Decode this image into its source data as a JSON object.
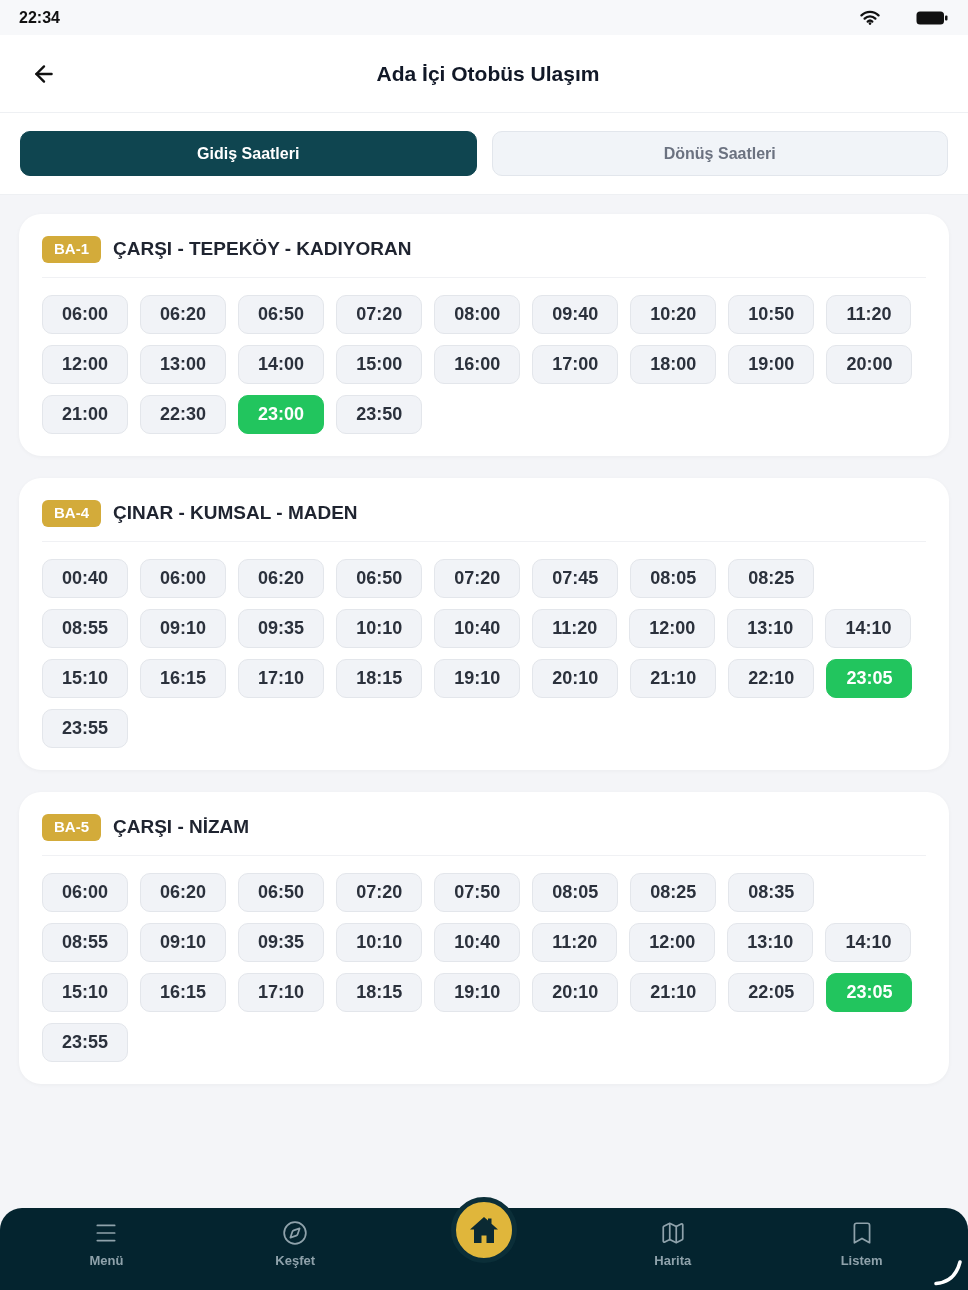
{
  "status_bar": {
    "time": "22:34"
  },
  "header": {
    "title": "Ada İçi Otobüs Ulaşım"
  },
  "tabs": [
    {
      "label": "Gidiş Saatleri",
      "selected": true
    },
    {
      "label": "Dönüş Saatleri",
      "selected": false
    }
  ],
  "routes": [
    {
      "code": "BA-1",
      "name": "ÇARŞI - TEPEKÖY - KADIYORAN",
      "rows": [
        [
          {
            "time": "06:00",
            "highlighted": false
          },
          {
            "time": "06:20",
            "highlighted": false
          },
          {
            "time": "06:50",
            "highlighted": false
          },
          {
            "time": "07:20",
            "highlighted": false
          },
          {
            "time": "08:00",
            "highlighted": false
          },
          {
            "time": "09:40",
            "highlighted": false
          },
          {
            "time": "10:20",
            "highlighted": false
          },
          {
            "time": "10:50",
            "highlighted": false
          },
          {
            "time": "11:20",
            "highlighted": false
          }
        ],
        [
          {
            "time": "12:00",
            "highlighted": false
          },
          {
            "time": "13:00",
            "highlighted": false
          },
          {
            "time": "14:00",
            "highlighted": false
          },
          {
            "time": "15:00",
            "highlighted": false
          },
          {
            "time": "16:00",
            "highlighted": false
          },
          {
            "time": "17:00",
            "highlighted": false
          },
          {
            "time": "18:00",
            "highlighted": false
          },
          {
            "time": "19:00",
            "highlighted": false
          },
          {
            "time": "20:00",
            "highlighted": false
          }
        ],
        [
          {
            "time": "21:00",
            "highlighted": false
          },
          {
            "time": "22:30",
            "highlighted": false
          },
          {
            "time": "23:00",
            "highlighted": true
          },
          {
            "time": "23:50",
            "highlighted": false
          }
        ]
      ]
    },
    {
      "code": "BA-4",
      "name": "ÇINAR - KUMSAL - MADEN",
      "rows": [
        [
          {
            "time": "00:40",
            "highlighted": false
          },
          {
            "time": "06:00",
            "highlighted": false
          },
          {
            "time": "06:20",
            "highlighted": false
          },
          {
            "time": "06:50",
            "highlighted": false
          },
          {
            "time": "07:20",
            "highlighted": false
          },
          {
            "time": "07:45",
            "highlighted": false
          },
          {
            "time": "08:05",
            "highlighted": false
          },
          {
            "time": "08:25",
            "highlighted": false
          }
        ],
        [
          {
            "time": "08:55",
            "highlighted": false
          },
          {
            "time": "09:10",
            "highlighted": false
          },
          {
            "time": "09:35",
            "highlighted": false
          },
          {
            "time": "10:10",
            "highlighted": false
          },
          {
            "time": "10:40",
            "highlighted": false
          },
          {
            "time": "11:20",
            "highlighted": false
          },
          {
            "time": "12:00",
            "highlighted": false
          },
          {
            "time": "13:10",
            "highlighted": false
          },
          {
            "time": "14:10",
            "highlighted": false
          }
        ],
        [
          {
            "time": "15:10",
            "highlighted": false
          },
          {
            "time": "16:15",
            "highlighted": false
          },
          {
            "time": "17:10",
            "highlighted": false
          },
          {
            "time": "18:15",
            "highlighted": false
          },
          {
            "time": "19:10",
            "highlighted": false
          },
          {
            "time": "20:10",
            "highlighted": false
          },
          {
            "time": "21:10",
            "highlighted": false
          },
          {
            "time": "22:10",
            "highlighted": false
          },
          {
            "time": "23:05",
            "highlighted": true
          }
        ],
        [
          {
            "time": "23:55",
            "highlighted": false
          }
        ]
      ]
    },
    {
      "code": "BA-5",
      "name": "ÇARŞI - NİZAM",
      "rows": [
        [
          {
            "time": "06:00",
            "highlighted": false
          },
          {
            "time": "06:20",
            "highlighted": false
          },
          {
            "time": "06:50",
            "highlighted": false
          },
          {
            "time": "07:20",
            "highlighted": false
          },
          {
            "time": "07:50",
            "highlighted": false
          },
          {
            "time": "08:05",
            "highlighted": false
          },
          {
            "time": "08:25",
            "highlighted": false
          },
          {
            "time": "08:35",
            "highlighted": false
          }
        ],
        [
          {
            "time": "08:55",
            "highlighted": false
          },
          {
            "time": "09:10",
            "highlighted": false
          },
          {
            "time": "09:35",
            "highlighted": false
          },
          {
            "time": "10:10",
            "highlighted": false
          },
          {
            "time": "10:40",
            "highlighted": false
          },
          {
            "time": "11:20",
            "highlighted": false
          },
          {
            "time": "12:00",
            "highlighted": false
          },
          {
            "time": "13:10",
            "highlighted": false
          },
          {
            "time": "14:10",
            "highlighted": false
          }
        ],
        [
          {
            "time": "15:10",
            "highlighted": false
          },
          {
            "time": "16:15",
            "highlighted": false
          },
          {
            "time": "17:10",
            "highlighted": false
          },
          {
            "time": "18:15",
            "highlighted": false
          },
          {
            "time": "19:10",
            "highlighted": false
          },
          {
            "time": "20:10",
            "highlighted": false
          },
          {
            "time": "21:10",
            "highlighted": false
          },
          {
            "time": "22:05",
            "highlighted": false
          },
          {
            "time": "23:05",
            "highlighted": true
          }
        ],
        [
          {
            "time": "23:55",
            "highlighted": false
          }
        ]
      ]
    }
  ],
  "bottom_nav": {
    "items": [
      {
        "label": "Menü"
      },
      {
        "label": "Keşfet"
      },
      {
        "label": "Harita"
      },
      {
        "label": "Listem"
      }
    ]
  }
}
